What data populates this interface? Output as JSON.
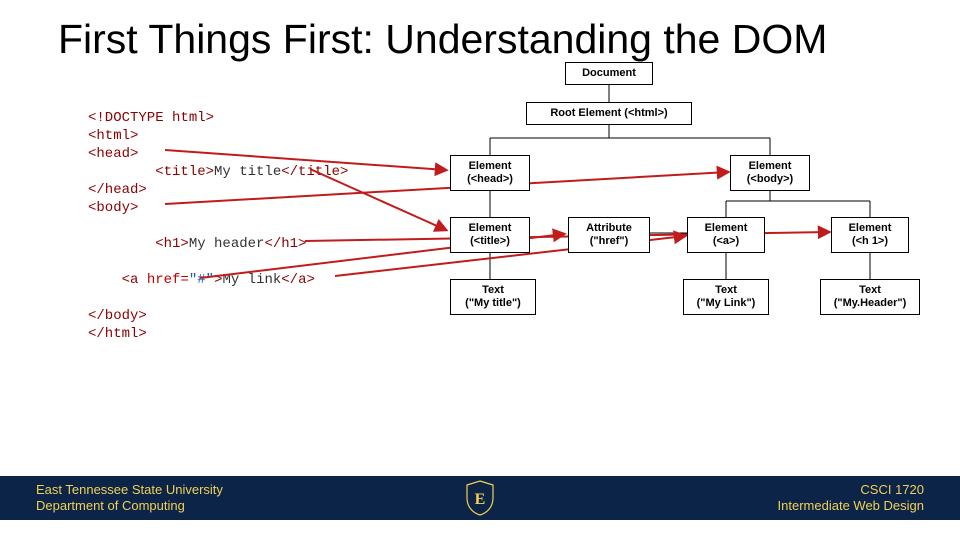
{
  "title": "First Things First: Understanding the DOM",
  "code_lines": [
    {
      "indent": 0,
      "type": "tag",
      "text": "<!DOCTYPE html>"
    },
    {
      "indent": 0,
      "type": "tag",
      "text": "<html>"
    },
    {
      "indent": 0,
      "type": "tag",
      "text": "<head>"
    },
    {
      "indent": 2,
      "type": "mixed",
      "parts": [
        {
          "cls": "tag",
          "t": "<title>"
        },
        {
          "cls": "text",
          "t": "My title"
        },
        {
          "cls": "tag",
          "t": "</title>"
        }
      ]
    },
    {
      "indent": 0,
      "type": "tag",
      "text": "</head>"
    },
    {
      "indent": 0,
      "type": "tag",
      "text": "<body>"
    },
    {
      "indent": 0,
      "type": "blank",
      "text": ""
    },
    {
      "indent": 2,
      "type": "mixed",
      "parts": [
        {
          "cls": "tag",
          "t": "<h1>"
        },
        {
          "cls": "text",
          "t": "My header"
        },
        {
          "cls": "tag",
          "t": "</h1>"
        }
      ]
    },
    {
      "indent": 0,
      "type": "blank",
      "text": ""
    },
    {
      "indent": 1,
      "type": "mixed",
      "parts": [
        {
          "cls": "tag",
          "t": "<a "
        },
        {
          "cls": "attr",
          "t": "href="
        },
        {
          "cls": "val",
          "t": "\"#\""
        },
        {
          "cls": "tag",
          "t": ">"
        },
        {
          "cls": "text",
          "t": "My link"
        },
        {
          "cls": "tag",
          "t": "</a>"
        }
      ]
    },
    {
      "indent": 0,
      "type": "blank",
      "text": ""
    },
    {
      "indent": 0,
      "type": "tag",
      "text": "</body>"
    },
    {
      "indent": 0,
      "type": "tag",
      "text": "</html>"
    }
  ],
  "nodes": {
    "document": {
      "text": "Document"
    },
    "root": {
      "text": "Root Element (<html>)"
    },
    "head": {
      "l1": "Element",
      "l2": "(<head>)"
    },
    "body": {
      "l1": "Element",
      "l2": "(<body>)"
    },
    "titleEl": {
      "l1": "Element",
      "l2": "(<title>)"
    },
    "attr": {
      "l1": "Attribute",
      "l2": "(\"href\")"
    },
    "a": {
      "l1": "Element",
      "l2": "(<a>)"
    },
    "h1": {
      "l1": "Element",
      "l2": "(<h 1>)"
    },
    "t_title": {
      "l1": "Text",
      "l2": "(\"My title\")"
    },
    "t_link": {
      "l1": "Text",
      "l2": "(\"My Link\")"
    },
    "t_header": {
      "l1": "Text",
      "l2": "(\"My.Header\")"
    }
  },
  "footer": {
    "left1": "East Tennessee State University",
    "left2": "Department of Computing",
    "right1": "CSCI 1720",
    "right2": "Intermediate Web Design",
    "shield_letter": "E"
  }
}
